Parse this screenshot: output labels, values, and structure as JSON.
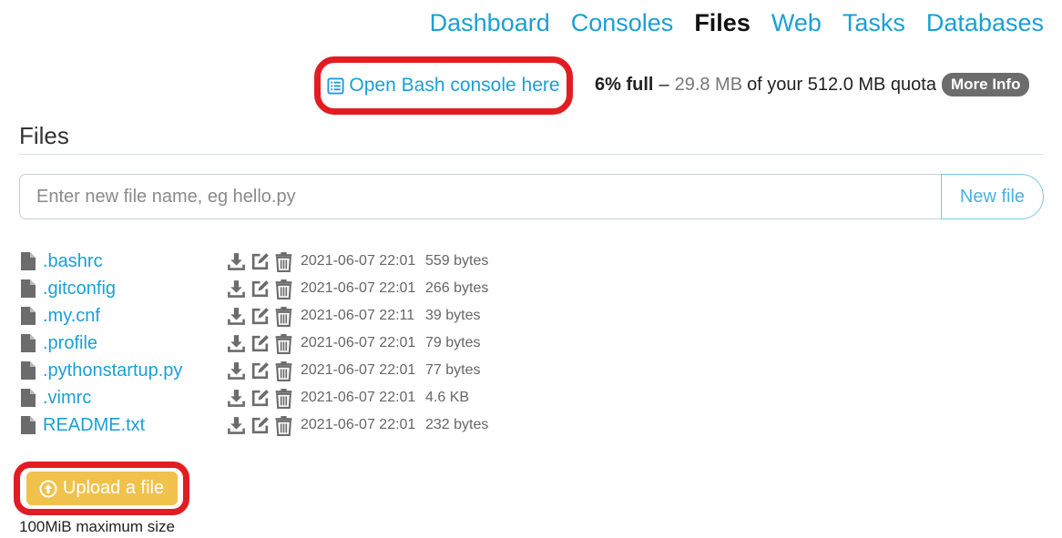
{
  "nav": {
    "items": [
      {
        "label": "Dashboard",
        "active": false
      },
      {
        "label": "Consoles",
        "active": false
      },
      {
        "label": "Files",
        "active": true
      },
      {
        "label": "Web",
        "active": false
      },
      {
        "label": "Tasks",
        "active": false
      },
      {
        "label": "Databases",
        "active": false
      }
    ]
  },
  "bash": {
    "label": "Open Bash console here",
    "icon": "console-list-icon"
  },
  "quota": {
    "percent": "6% full",
    "separator": "–",
    "used": "29.8 MB",
    "rest": "of your 512.0 MB quota",
    "more_info": "More Info"
  },
  "section": {
    "title": "Files"
  },
  "new_file": {
    "placeholder": "Enter new file name, eg hello.py",
    "value": "",
    "button": "New file"
  },
  "files": [
    {
      "name": ".bashrc",
      "mtime": "2021-06-07 22:01",
      "size": "559 bytes"
    },
    {
      "name": ".gitconfig",
      "mtime": "2021-06-07 22:01",
      "size": "266 bytes"
    },
    {
      "name": ".my.cnf",
      "mtime": "2021-06-07 22:11",
      "size": "39 bytes"
    },
    {
      "name": ".profile",
      "mtime": "2021-06-07 22:01",
      "size": "79 bytes"
    },
    {
      "name": ".pythonstartup.py",
      "mtime": "2021-06-07 22:01",
      "size": "77 bytes"
    },
    {
      "name": ".vimrc",
      "mtime": "2021-06-07 22:01",
      "size": "4.6 KB"
    },
    {
      "name": "README.txt",
      "mtime": "2021-06-07 22:01",
      "size": "232 bytes"
    }
  ],
  "upload": {
    "label": "Upload a file",
    "note": "100MiB maximum size",
    "icon": "upload-circle-icon"
  },
  "colors": {
    "link": "#1a9fd6",
    "highlight": "#e11d22",
    "upload": "#f0c24b",
    "icon": "#6c6c6c"
  }
}
